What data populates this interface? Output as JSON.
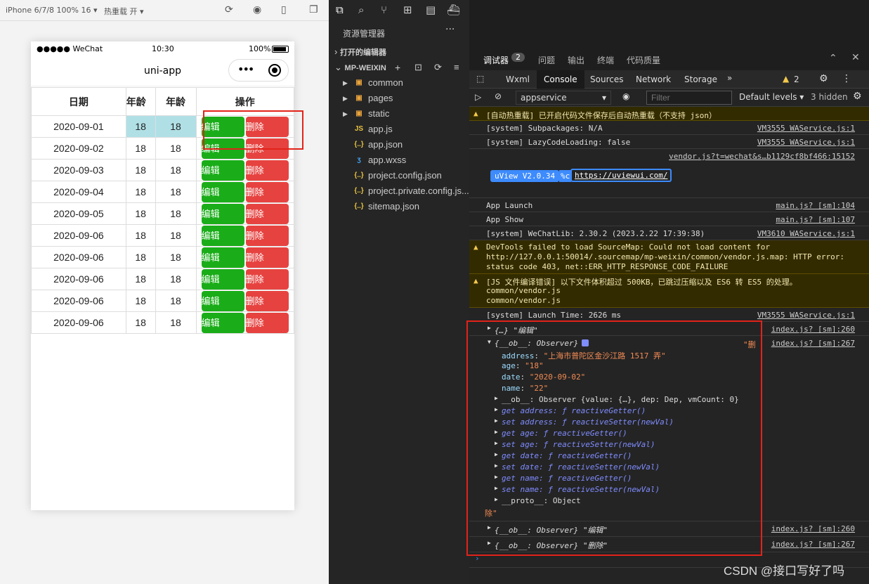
{
  "simulator": {
    "device": "iPhone 6/7/8 100% 16",
    "hot_reload": "热重载 开"
  },
  "phone": {
    "carrier": "●●●●● WeChat",
    "time": "10:30",
    "battery": "100%",
    "title": "uni-app",
    "columns": [
      "日期",
      "年龄",
      "年龄",
      "操作"
    ],
    "edit_label": "编辑",
    "delete_label": "删除",
    "rows": [
      {
        "date": "2020-09-01",
        "a": "18",
        "b": "18"
      },
      {
        "date": "2020-09-02",
        "a": "18",
        "b": "18"
      },
      {
        "date": "2020-09-03",
        "a": "18",
        "b": "18"
      },
      {
        "date": "2020-09-04",
        "a": "18",
        "b": "18"
      },
      {
        "date": "2020-09-05",
        "a": "18",
        "b": "18"
      },
      {
        "date": "2020-09-06",
        "a": "18",
        "b": "18"
      },
      {
        "date": "2020-09-06",
        "a": "18",
        "b": "18"
      },
      {
        "date": "2020-09-06",
        "a": "18",
        "b": "18"
      },
      {
        "date": "2020-09-06",
        "a": "18",
        "b": "18"
      },
      {
        "date": "2020-09-06",
        "a": "18",
        "b": "18"
      }
    ]
  },
  "explorer": {
    "title": "资源管理器",
    "open_editors": "打开的编辑器",
    "project": "MP-WEIXIN",
    "items": [
      {
        "name": "common",
        "type": "folder",
        "icon": "folder-icon"
      },
      {
        "name": "pages",
        "type": "folder",
        "icon": "folder-icon"
      },
      {
        "name": "static",
        "type": "folder",
        "icon": "folder-icon"
      },
      {
        "name": "app.js",
        "type": "file",
        "icon": "js-icon"
      },
      {
        "name": "app.json",
        "type": "file",
        "icon": "json-icon"
      },
      {
        "name": "app.wxss",
        "type": "file",
        "icon": "css-icon"
      },
      {
        "name": "project.config.json",
        "type": "file",
        "icon": "json-icon"
      },
      {
        "name": "project.private.config.js...",
        "type": "file",
        "icon": "json-icon"
      },
      {
        "name": "sitemap.json",
        "type": "file",
        "icon": "json-icon"
      }
    ]
  },
  "devtools": {
    "top_tabs": [
      "调试器",
      "问题",
      "输出",
      "终端",
      "代码质量"
    ],
    "debugger_badge": "2",
    "panel_tabs": [
      "Wxml",
      "Console",
      "Sources",
      "Network",
      "Storage"
    ],
    "warn_count": "2",
    "context": "appservice",
    "filter_placeholder": "Filter",
    "levels": "Default levels ▾",
    "hidden": "3 hidden",
    "logs": [
      {
        "text": "[自动热重载] 已开启代码文件保存后自动热重载（不支持 json）",
        "src": ""
      },
      {
        "text": "[system] Subpackages: N/A",
        "src": "VM3555 WAService.js:1"
      },
      {
        "text": "[system] LazyCodeLoading: false",
        "src": "VM3555 WAService.js:1"
      },
      {
        "text": "",
        "src": "vendor.js?t=wechat&s…b1129cf8bf466:15152"
      },
      {
        "text": "App Launch",
        "src": "main.js? [sm]:104"
      },
      {
        "text": "App Show",
        "src": "main.js? [sm]:107"
      },
      {
        "text": "[system] WeChatLib: 2.30.2 (2023.2.22 17:39:38)",
        "src": "VM3610 WAService.js:1"
      },
      {
        "text": "DevTools failed to load SourceMap: Could not load content for http://127.0.0.1:50014/.sourcemap/mp-weixin/common/vendor.js.map: HTTP error: status code 403, net::ERR_HTTP_RESPONSE_CODE_FAILURE",
        "src": ""
      },
      {
        "text": "[JS 文件编译错误] 以下文件体积超过 500KB，已跳过压缩以及 ES6 转 ES5 的处理。",
        "src": ""
      },
      {
        "text": "[system] Launch Time: 2626 ms",
        "src": "VM3555 WAService.js:1"
      }
    ],
    "uview": {
      "badge": "uView V2.0.34",
      "pct": "%c",
      "link": "https://uviewui.com/"
    },
    "vendor_files": [
      "common/vendor.js",
      "common/vendor.js"
    ],
    "obj_log1": {
      "text": "{…} \"编辑\"",
      "src": "index.js? [sm]:260"
    },
    "obj_log2": {
      "head": "{__ob__: Observer}",
      "tail": "\"删",
      "src": "index.js? [sm]:267",
      "props": [
        {
          "k": "address",
          "v": "\"上海市普陀区金沙江路 1517 弄\""
        },
        {
          "k": "age",
          "v": "\"18\""
        },
        {
          "k": "date",
          "v": "\"2020-09-02\""
        },
        {
          "k": "name",
          "v": "\"22\""
        }
      ],
      "ob": "__ob__: Observer {value: {…}, dep: Dep, vmCount: 0}",
      "accessors": [
        "get address: ƒ reactiveGetter()",
        "set address: ƒ reactiveSetter(newVal)",
        "get age: ƒ reactiveGetter()",
        "set age: ƒ reactiveSetter(newVal)",
        "get date: ƒ reactiveGetter()",
        "set date: ƒ reactiveSetter(newVal)",
        "get name: ƒ reactiveGetter()",
        "set name: ƒ reactiveSetter(newVal)"
      ],
      "proto": "__proto__: Object",
      "end": "除\""
    },
    "obj_log3": {
      "text": "{__ob__: Observer} \"编辑\"",
      "src": "index.js? [sm]:260"
    },
    "obj_log4": {
      "text": "{__ob__: Observer} \"删除\"",
      "src": "index.js? [sm]:267"
    }
  },
  "watermark": "CSDN @接口写好了吗"
}
